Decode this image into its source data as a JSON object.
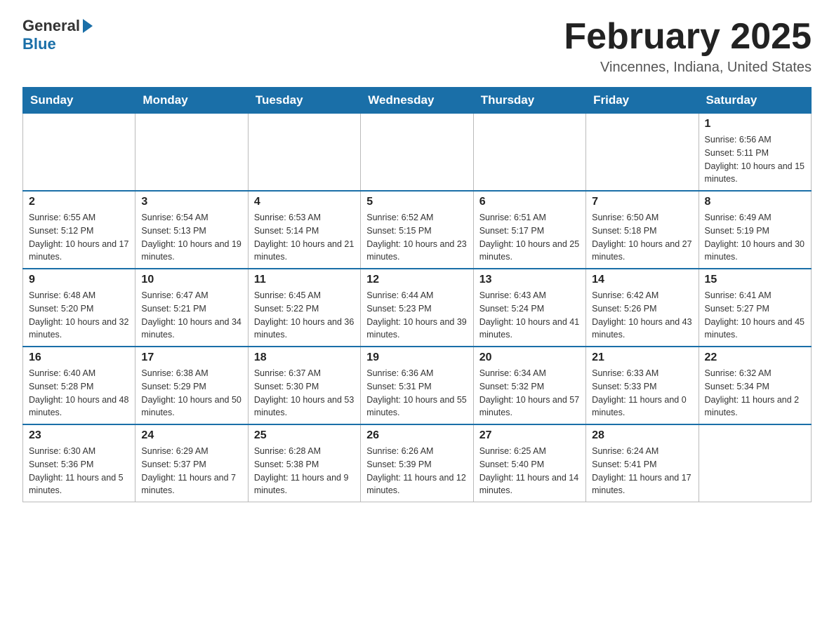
{
  "logo": {
    "text_general": "General",
    "text_blue": "Blue"
  },
  "header": {
    "title": "February 2025",
    "location": "Vincennes, Indiana, United States"
  },
  "weekdays": [
    "Sunday",
    "Monday",
    "Tuesday",
    "Wednesday",
    "Thursday",
    "Friday",
    "Saturday"
  ],
  "weeks": [
    [
      {
        "day": "",
        "info": ""
      },
      {
        "day": "",
        "info": ""
      },
      {
        "day": "",
        "info": ""
      },
      {
        "day": "",
        "info": ""
      },
      {
        "day": "",
        "info": ""
      },
      {
        "day": "",
        "info": ""
      },
      {
        "day": "1",
        "info": "Sunrise: 6:56 AM\nSunset: 5:11 PM\nDaylight: 10 hours and 15 minutes."
      }
    ],
    [
      {
        "day": "2",
        "info": "Sunrise: 6:55 AM\nSunset: 5:12 PM\nDaylight: 10 hours and 17 minutes."
      },
      {
        "day": "3",
        "info": "Sunrise: 6:54 AM\nSunset: 5:13 PM\nDaylight: 10 hours and 19 minutes."
      },
      {
        "day": "4",
        "info": "Sunrise: 6:53 AM\nSunset: 5:14 PM\nDaylight: 10 hours and 21 minutes."
      },
      {
        "day": "5",
        "info": "Sunrise: 6:52 AM\nSunset: 5:15 PM\nDaylight: 10 hours and 23 minutes."
      },
      {
        "day": "6",
        "info": "Sunrise: 6:51 AM\nSunset: 5:17 PM\nDaylight: 10 hours and 25 minutes."
      },
      {
        "day": "7",
        "info": "Sunrise: 6:50 AM\nSunset: 5:18 PM\nDaylight: 10 hours and 27 minutes."
      },
      {
        "day": "8",
        "info": "Sunrise: 6:49 AM\nSunset: 5:19 PM\nDaylight: 10 hours and 30 minutes."
      }
    ],
    [
      {
        "day": "9",
        "info": "Sunrise: 6:48 AM\nSunset: 5:20 PM\nDaylight: 10 hours and 32 minutes."
      },
      {
        "day": "10",
        "info": "Sunrise: 6:47 AM\nSunset: 5:21 PM\nDaylight: 10 hours and 34 minutes."
      },
      {
        "day": "11",
        "info": "Sunrise: 6:45 AM\nSunset: 5:22 PM\nDaylight: 10 hours and 36 minutes."
      },
      {
        "day": "12",
        "info": "Sunrise: 6:44 AM\nSunset: 5:23 PM\nDaylight: 10 hours and 39 minutes."
      },
      {
        "day": "13",
        "info": "Sunrise: 6:43 AM\nSunset: 5:24 PM\nDaylight: 10 hours and 41 minutes."
      },
      {
        "day": "14",
        "info": "Sunrise: 6:42 AM\nSunset: 5:26 PM\nDaylight: 10 hours and 43 minutes."
      },
      {
        "day": "15",
        "info": "Sunrise: 6:41 AM\nSunset: 5:27 PM\nDaylight: 10 hours and 45 minutes."
      }
    ],
    [
      {
        "day": "16",
        "info": "Sunrise: 6:40 AM\nSunset: 5:28 PM\nDaylight: 10 hours and 48 minutes."
      },
      {
        "day": "17",
        "info": "Sunrise: 6:38 AM\nSunset: 5:29 PM\nDaylight: 10 hours and 50 minutes."
      },
      {
        "day": "18",
        "info": "Sunrise: 6:37 AM\nSunset: 5:30 PM\nDaylight: 10 hours and 53 minutes."
      },
      {
        "day": "19",
        "info": "Sunrise: 6:36 AM\nSunset: 5:31 PM\nDaylight: 10 hours and 55 minutes."
      },
      {
        "day": "20",
        "info": "Sunrise: 6:34 AM\nSunset: 5:32 PM\nDaylight: 10 hours and 57 minutes."
      },
      {
        "day": "21",
        "info": "Sunrise: 6:33 AM\nSunset: 5:33 PM\nDaylight: 11 hours and 0 minutes."
      },
      {
        "day": "22",
        "info": "Sunrise: 6:32 AM\nSunset: 5:34 PM\nDaylight: 11 hours and 2 minutes."
      }
    ],
    [
      {
        "day": "23",
        "info": "Sunrise: 6:30 AM\nSunset: 5:36 PM\nDaylight: 11 hours and 5 minutes."
      },
      {
        "day": "24",
        "info": "Sunrise: 6:29 AM\nSunset: 5:37 PM\nDaylight: 11 hours and 7 minutes."
      },
      {
        "day": "25",
        "info": "Sunrise: 6:28 AM\nSunset: 5:38 PM\nDaylight: 11 hours and 9 minutes."
      },
      {
        "day": "26",
        "info": "Sunrise: 6:26 AM\nSunset: 5:39 PM\nDaylight: 11 hours and 12 minutes."
      },
      {
        "day": "27",
        "info": "Sunrise: 6:25 AM\nSunset: 5:40 PM\nDaylight: 11 hours and 14 minutes."
      },
      {
        "day": "28",
        "info": "Sunrise: 6:24 AM\nSunset: 5:41 PM\nDaylight: 11 hours and 17 minutes."
      },
      {
        "day": "",
        "info": ""
      }
    ]
  ]
}
